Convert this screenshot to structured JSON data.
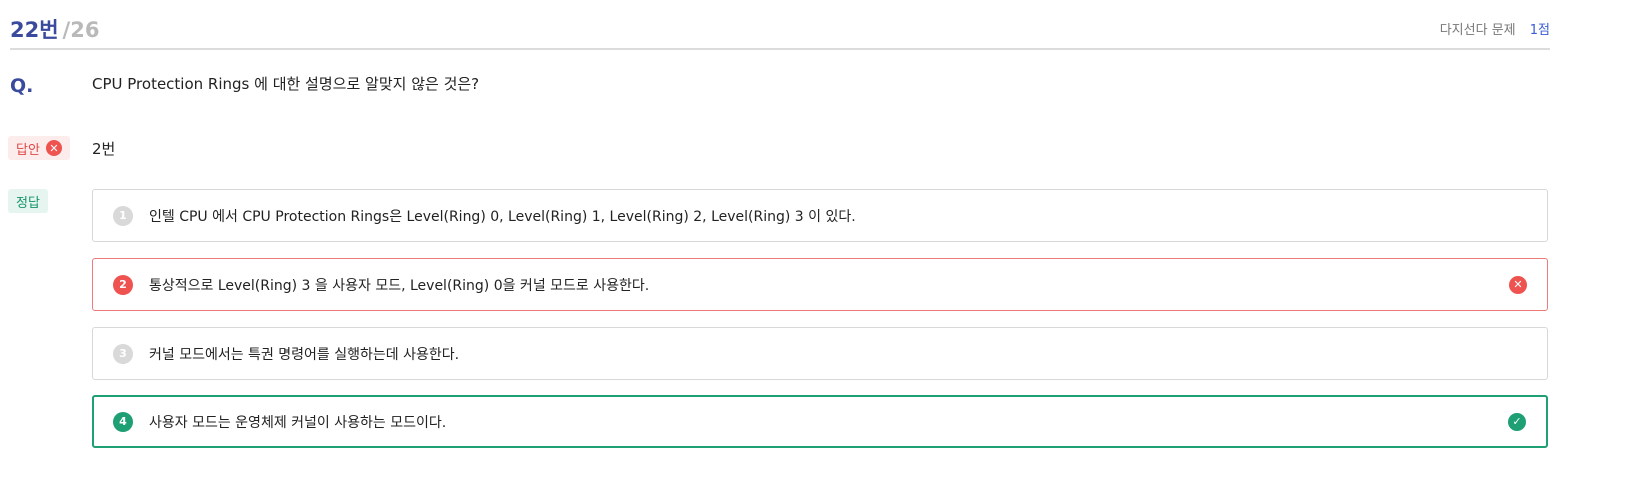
{
  "header": {
    "question_number": "22번",
    "question_total": "/26",
    "type": "다지선다 문제",
    "points": "1점"
  },
  "question": {
    "label": "Q.",
    "text": "CPU Protection Rings 에 대한 설명으로 알맞지 않은 것은?"
  },
  "answer": {
    "label": "답안",
    "value": "2번",
    "status": "wrong"
  },
  "correct": {
    "label": "정답"
  },
  "choices": [
    {
      "number": "1",
      "text": "인텔 CPU 에서 CPU Protection Rings은 Level(Ring) 0, Level(Ring) 1, Level(Ring) 2, Level(Ring) 3 이 있다."
    },
    {
      "number": "2",
      "text": "통상적으로 Level(Ring) 3 을 사용자 모드, Level(Ring) 0을 커널 모드로 사용한다.",
      "state": "selected-wrong"
    },
    {
      "number": "3",
      "text": "커널 모드에서는 특권 명령어를 실행하는데 사용한다."
    },
    {
      "number": "4",
      "text": "사용자 모드는 운영체제 커널이 사용하는 모드이다.",
      "state": "correct"
    }
  ],
  "colors": {
    "accent": "#3a4a9c",
    "wrong": "#ef5350",
    "correct": "#1e9f74"
  }
}
